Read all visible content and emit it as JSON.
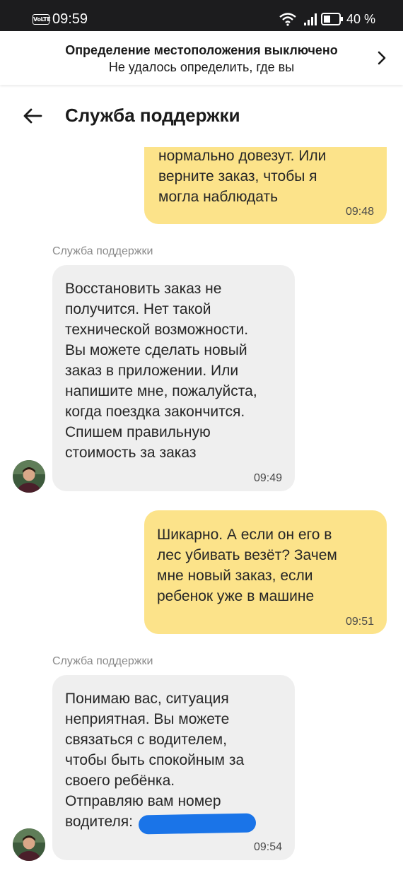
{
  "status_bar": {
    "volte": "VoLTE",
    "time": "09:59",
    "battery": "40 %"
  },
  "location_banner": {
    "title": "Определение местоположения выключено",
    "subtitle": "Не удалось определить, где вы"
  },
  "header": {
    "title": "Служба поддержки"
  },
  "messages": [
    {
      "direction": "out",
      "text": "нормально довезут. Или\nверните заказ, чтобы я\nмогла наблюдать",
      "time": "09:48"
    },
    {
      "direction": "in",
      "sender": "Служба поддержки",
      "text": "Восстановить заказ не\nполучится. Нет такой\nтехнической возможности.\nВы можете сделать новый\nзаказ в приложении. Или\nнапишите мне, пожалуйста,\nкогда поездка закончится.\nСпишем правильную\nстоимость за заказ",
      "time": "09:49"
    },
    {
      "direction": "out",
      "text": "Шикарно. А если он его в\nлес убивать везёт? Зачем\nмне новый заказ, если\nребенок уже в машине",
      "time": "09:51"
    },
    {
      "direction": "in",
      "sender": "Служба поддержки",
      "text": "Понимаю вас, ситуация\nнеприятная. Вы можете\nсвязаться с водителем,\nчтобы быть спокойным за\nсвоего ребёнка.\nОтправляю вам номер\nводителя:",
      "time": "09:54"
    }
  ],
  "colors": {
    "outgoing_bubble": "#fce38a",
    "incoming_bubble": "#efefef",
    "redaction": "#1a74e8"
  }
}
